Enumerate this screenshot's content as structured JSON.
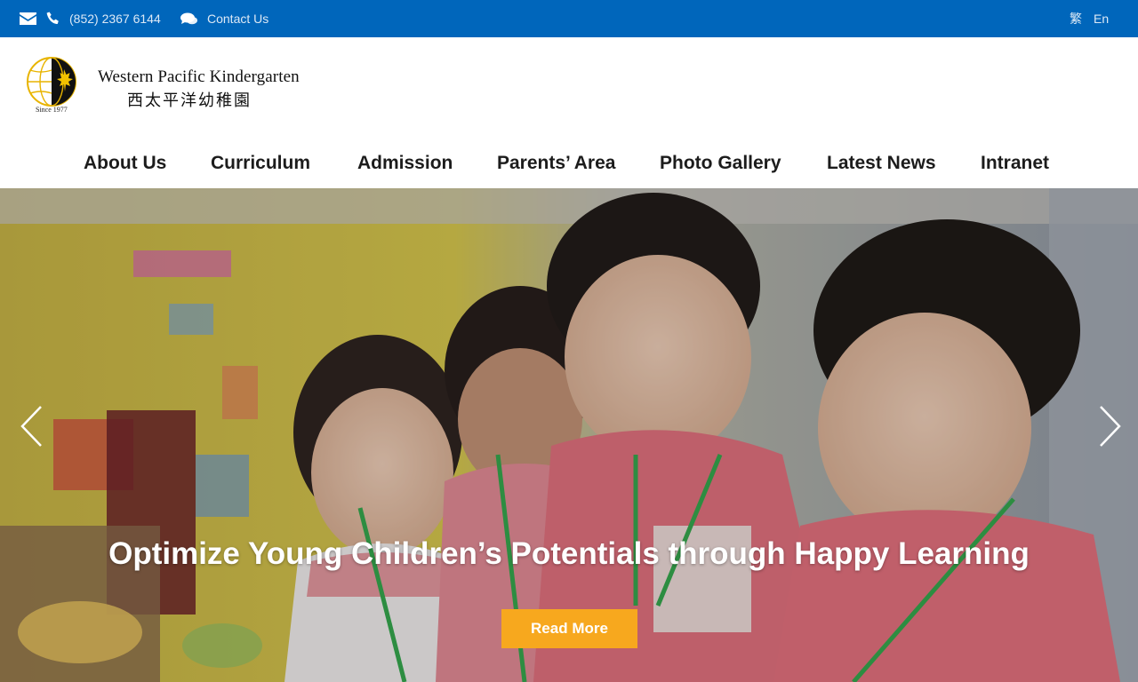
{
  "topbar": {
    "email_icon": "envelope-icon",
    "phone_icon": "phone-icon",
    "phone": "(852) 2367 6144",
    "contact_icon": "chat-bubbles-icon",
    "contact_label": "Contact Us",
    "lang_traditional": "繁",
    "lang_english": "En"
  },
  "logo": {
    "name_en": "Western Pacific Kindergarten",
    "name_zh": "西太平洋幼稚園",
    "since": "Since 1977"
  },
  "nav": {
    "items": [
      {
        "label": "About Us"
      },
      {
        "label": "Curriculum"
      },
      {
        "label": "Admission"
      },
      {
        "label": "Parents’ Area"
      },
      {
        "label": "Photo Gallery"
      },
      {
        "label": "Latest News"
      },
      {
        "label": "Intranet"
      }
    ]
  },
  "hero": {
    "headline": "Optimize Young Children’s Potentials through Happy Learning",
    "button_label": "Read More",
    "prev_icon": "chevron-left-icon",
    "next_icon": "chevron-right-icon"
  },
  "colors": {
    "topbar": "#0066bb",
    "button": "#f7a81e",
    "logo_gold": "#e8b400"
  }
}
